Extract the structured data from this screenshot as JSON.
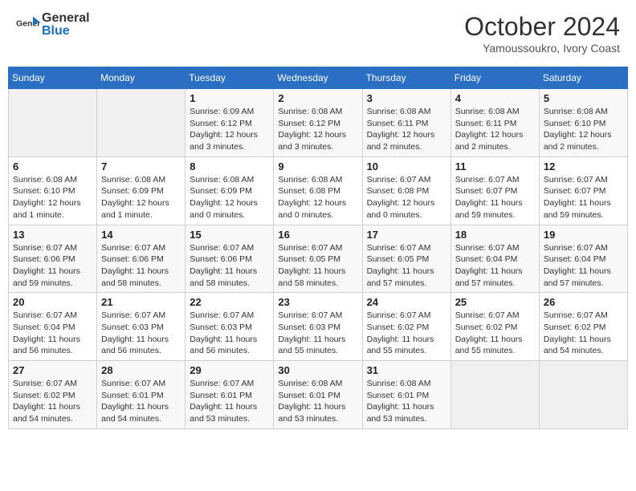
{
  "header": {
    "logo_general": "General",
    "logo_blue": "Blue",
    "month_title": "October 2024",
    "location": "Yamoussoukro, Ivory Coast"
  },
  "weekdays": [
    "Sunday",
    "Monday",
    "Tuesday",
    "Wednesday",
    "Thursday",
    "Friday",
    "Saturday"
  ],
  "weeks": [
    [
      {
        "day": "",
        "info": ""
      },
      {
        "day": "",
        "info": ""
      },
      {
        "day": "1",
        "info": "Sunrise: 6:09 AM\nSunset: 6:12 PM\nDaylight: 12 hours and 3 minutes."
      },
      {
        "day": "2",
        "info": "Sunrise: 6:08 AM\nSunset: 6:12 PM\nDaylight: 12 hours and 3 minutes."
      },
      {
        "day": "3",
        "info": "Sunrise: 6:08 AM\nSunset: 6:11 PM\nDaylight: 12 hours and 2 minutes."
      },
      {
        "day": "4",
        "info": "Sunrise: 6:08 AM\nSunset: 6:11 PM\nDaylight: 12 hours and 2 minutes."
      },
      {
        "day": "5",
        "info": "Sunrise: 6:08 AM\nSunset: 6:10 PM\nDaylight: 12 hours and 2 minutes."
      }
    ],
    [
      {
        "day": "6",
        "info": "Sunrise: 6:08 AM\nSunset: 6:10 PM\nDaylight: 12 hours and 1 minute."
      },
      {
        "day": "7",
        "info": "Sunrise: 6:08 AM\nSunset: 6:09 PM\nDaylight: 12 hours and 1 minute."
      },
      {
        "day": "8",
        "info": "Sunrise: 6:08 AM\nSunset: 6:09 PM\nDaylight: 12 hours and 0 minutes."
      },
      {
        "day": "9",
        "info": "Sunrise: 6:08 AM\nSunset: 6:08 PM\nDaylight: 12 hours and 0 minutes."
      },
      {
        "day": "10",
        "info": "Sunrise: 6:07 AM\nSunset: 6:08 PM\nDaylight: 12 hours and 0 minutes."
      },
      {
        "day": "11",
        "info": "Sunrise: 6:07 AM\nSunset: 6:07 PM\nDaylight: 11 hours and 59 minutes."
      },
      {
        "day": "12",
        "info": "Sunrise: 6:07 AM\nSunset: 6:07 PM\nDaylight: 11 hours and 59 minutes."
      }
    ],
    [
      {
        "day": "13",
        "info": "Sunrise: 6:07 AM\nSunset: 6:06 PM\nDaylight: 11 hours and 59 minutes."
      },
      {
        "day": "14",
        "info": "Sunrise: 6:07 AM\nSunset: 6:06 PM\nDaylight: 11 hours and 58 minutes."
      },
      {
        "day": "15",
        "info": "Sunrise: 6:07 AM\nSunset: 6:06 PM\nDaylight: 11 hours and 58 minutes."
      },
      {
        "day": "16",
        "info": "Sunrise: 6:07 AM\nSunset: 6:05 PM\nDaylight: 11 hours and 58 minutes."
      },
      {
        "day": "17",
        "info": "Sunrise: 6:07 AM\nSunset: 6:05 PM\nDaylight: 11 hours and 57 minutes."
      },
      {
        "day": "18",
        "info": "Sunrise: 6:07 AM\nSunset: 6:04 PM\nDaylight: 11 hours and 57 minutes."
      },
      {
        "day": "19",
        "info": "Sunrise: 6:07 AM\nSunset: 6:04 PM\nDaylight: 11 hours and 57 minutes."
      }
    ],
    [
      {
        "day": "20",
        "info": "Sunrise: 6:07 AM\nSunset: 6:04 PM\nDaylight: 11 hours and 56 minutes."
      },
      {
        "day": "21",
        "info": "Sunrise: 6:07 AM\nSunset: 6:03 PM\nDaylight: 11 hours and 56 minutes."
      },
      {
        "day": "22",
        "info": "Sunrise: 6:07 AM\nSunset: 6:03 PM\nDaylight: 11 hours and 56 minutes."
      },
      {
        "day": "23",
        "info": "Sunrise: 6:07 AM\nSunset: 6:03 PM\nDaylight: 11 hours and 55 minutes."
      },
      {
        "day": "24",
        "info": "Sunrise: 6:07 AM\nSunset: 6:02 PM\nDaylight: 11 hours and 55 minutes."
      },
      {
        "day": "25",
        "info": "Sunrise: 6:07 AM\nSunset: 6:02 PM\nDaylight: 11 hours and 55 minutes."
      },
      {
        "day": "26",
        "info": "Sunrise: 6:07 AM\nSunset: 6:02 PM\nDaylight: 11 hours and 54 minutes."
      }
    ],
    [
      {
        "day": "27",
        "info": "Sunrise: 6:07 AM\nSunset: 6:02 PM\nDaylight: 11 hours and 54 minutes."
      },
      {
        "day": "28",
        "info": "Sunrise: 6:07 AM\nSunset: 6:01 PM\nDaylight: 11 hours and 54 minutes."
      },
      {
        "day": "29",
        "info": "Sunrise: 6:07 AM\nSunset: 6:01 PM\nDaylight: 11 hours and 53 minutes."
      },
      {
        "day": "30",
        "info": "Sunrise: 6:08 AM\nSunset: 6:01 PM\nDaylight: 11 hours and 53 minutes."
      },
      {
        "day": "31",
        "info": "Sunrise: 6:08 AM\nSunset: 6:01 PM\nDaylight: 11 hours and 53 minutes."
      },
      {
        "day": "",
        "info": ""
      },
      {
        "day": "",
        "info": ""
      }
    ]
  ]
}
